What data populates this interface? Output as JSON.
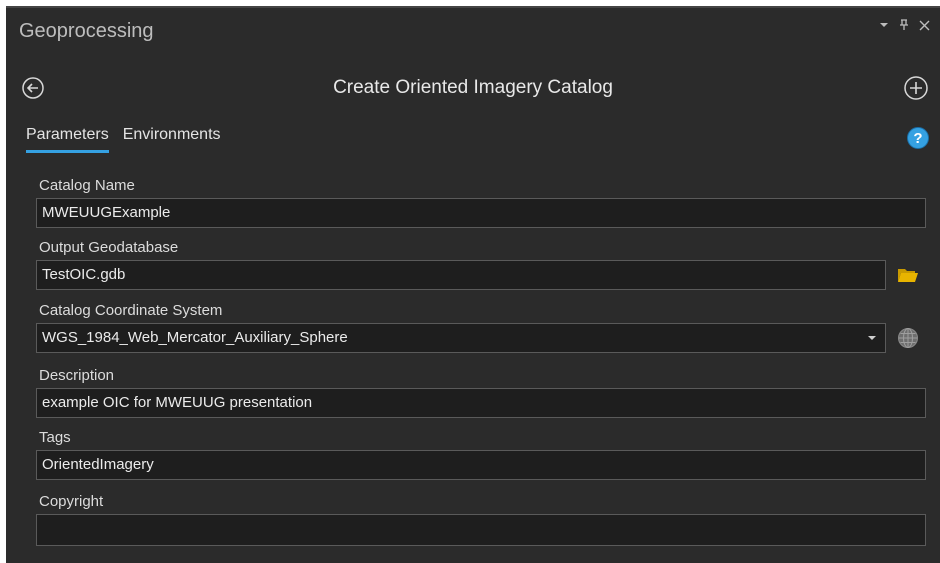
{
  "window": {
    "title": "Geoprocessing"
  },
  "tool": {
    "title": "Create Oriented Imagery Catalog"
  },
  "tabs": [
    {
      "label": "Parameters",
      "active": true
    },
    {
      "label": "Environments",
      "active": false
    }
  ],
  "fields": {
    "catalog_name": {
      "label": "Catalog Name",
      "value": "MWEUUGExample"
    },
    "output_gdb": {
      "label": "Output Geodatabase",
      "value": "TestOIC.gdb"
    },
    "coord_system": {
      "label": "Catalog Coordinate System",
      "value": "WGS_1984_Web_Mercator_Auxiliary_Sphere"
    },
    "description": {
      "label": "Description",
      "value": "example OIC for MWEUUG presentation"
    },
    "tags": {
      "label": "Tags",
      "value": "OrientedImagery"
    },
    "copyright": {
      "label": "Copyright",
      "value": ""
    }
  },
  "icons": {
    "back": "back-arrow-circle-icon",
    "add": "plus-circle-icon",
    "help": "help-circle-icon",
    "folder": "folder-open-icon",
    "globe": "globe-icon",
    "dropdown": "chevron-down-icon",
    "pin": "pin-icon",
    "close": "close-icon"
  },
  "colors": {
    "background": "#2b2b2b",
    "accent": "#35a1e2",
    "folder": "#e8b400",
    "input_bg": "#1e1e1e"
  }
}
